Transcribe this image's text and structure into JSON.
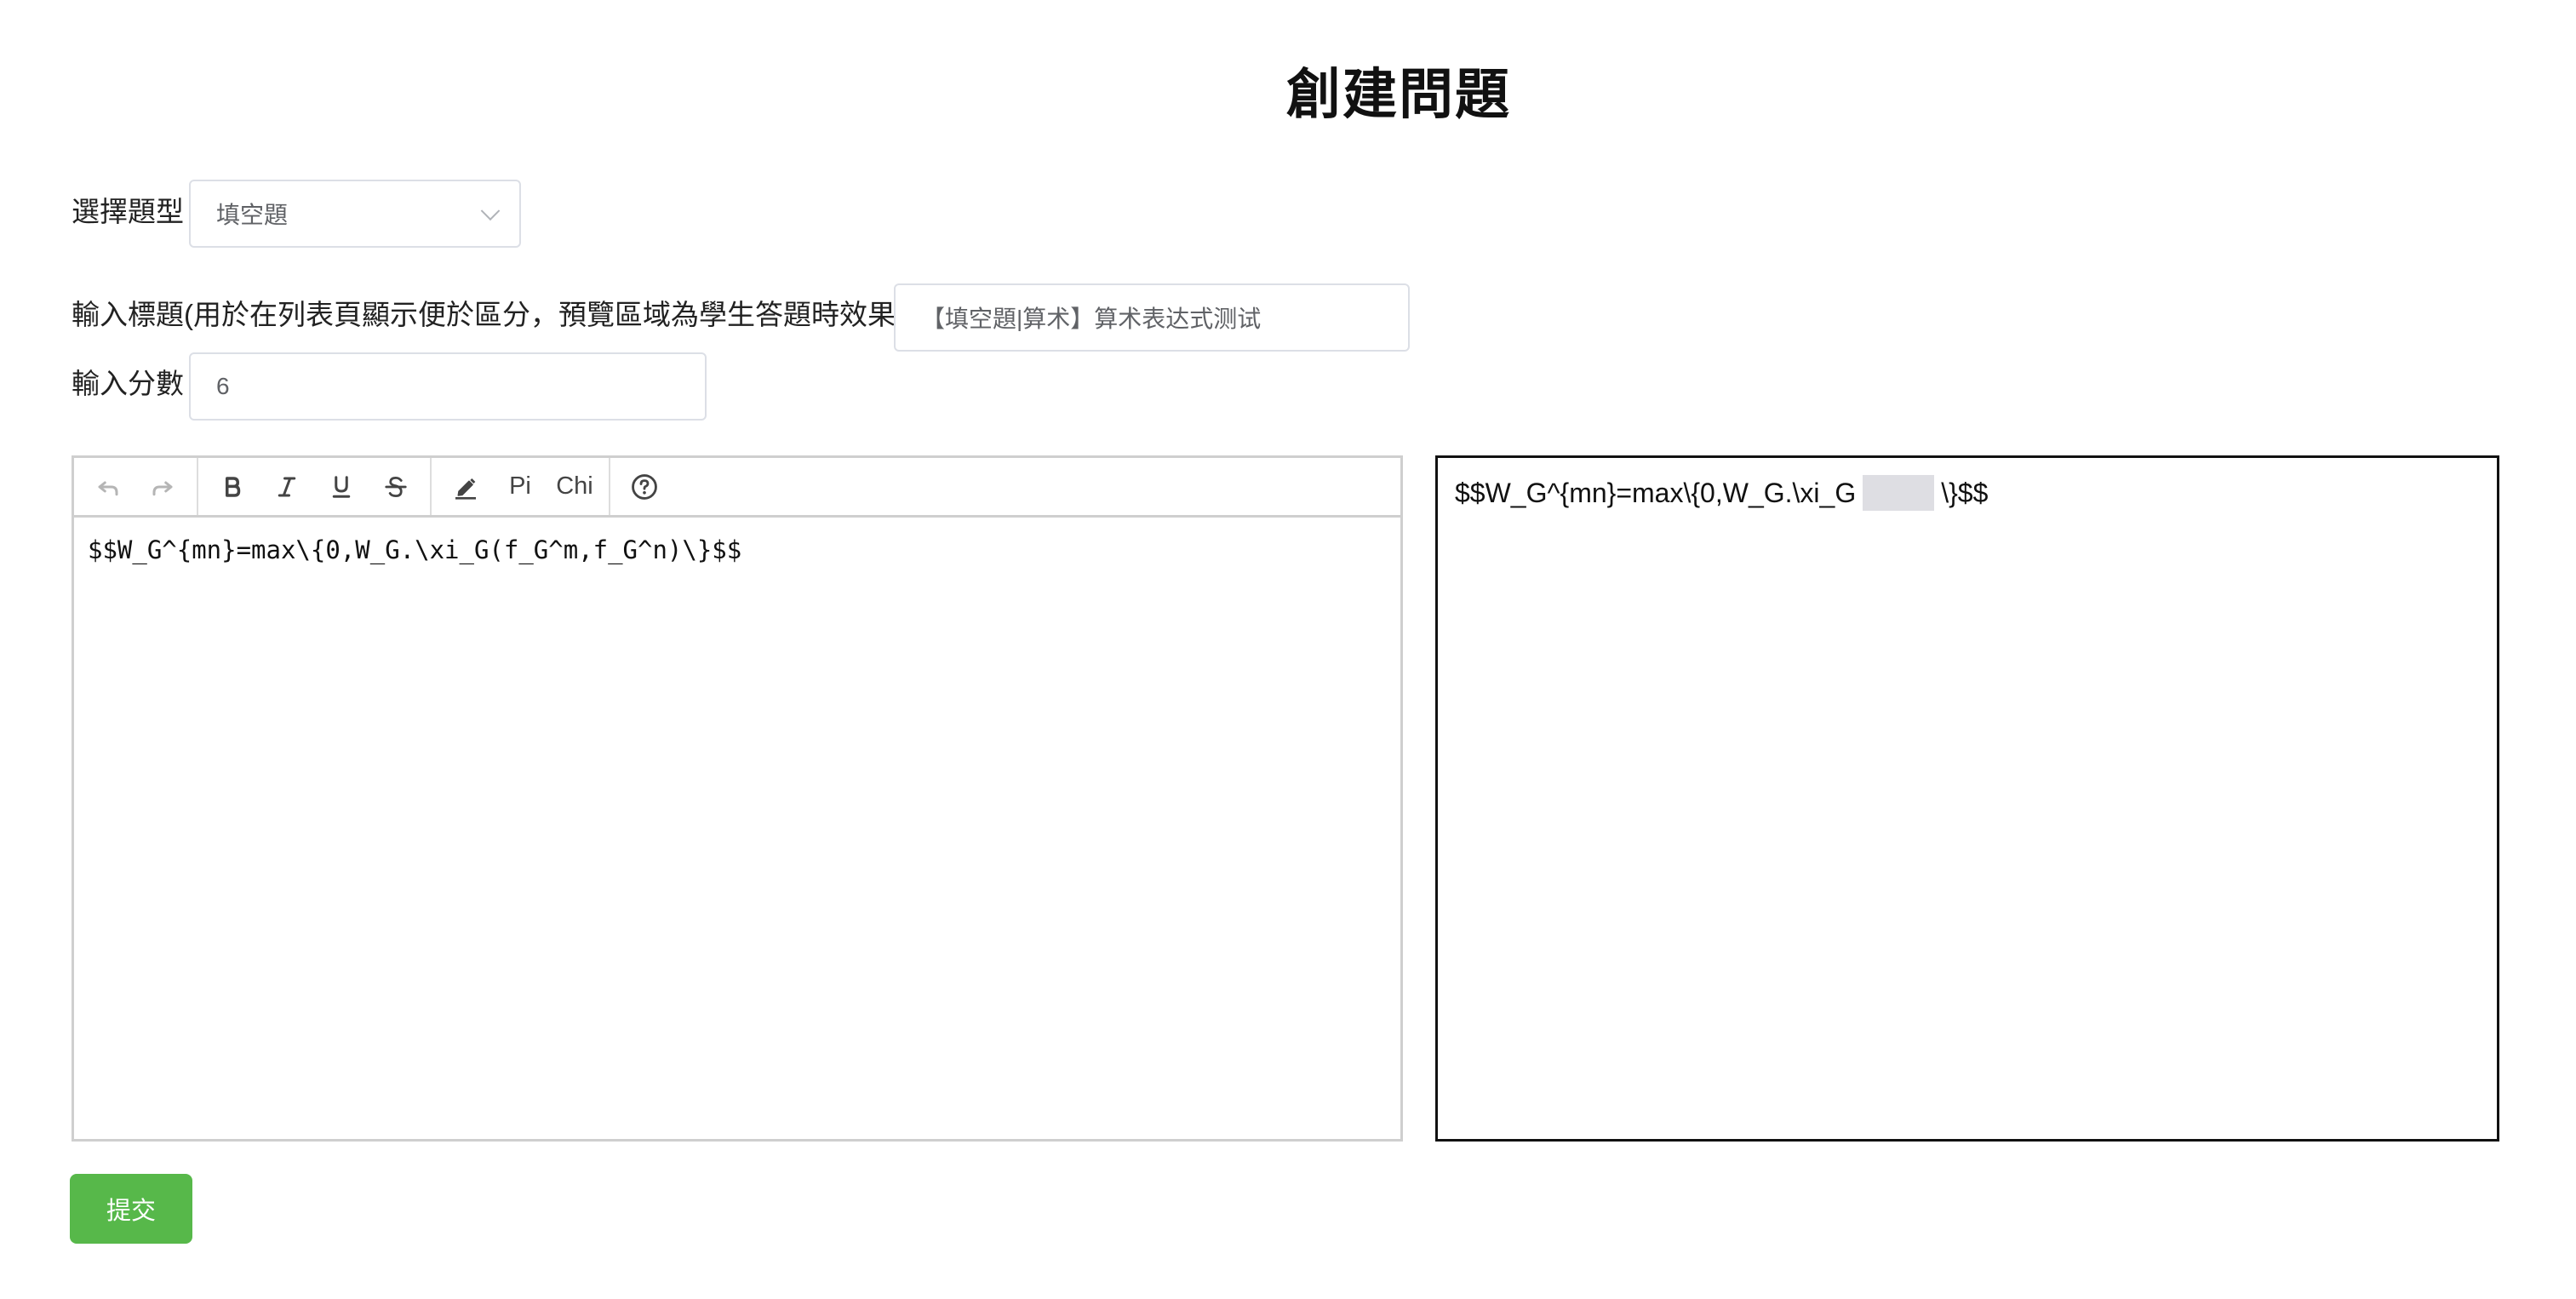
{
  "page": {
    "title": "創建問題"
  },
  "form": {
    "type_label": "選擇題型",
    "type_value": "填空題",
    "title_label": "輸入標題(用於在列表頁顯示便於區分，預覽區域為學生答題時效果)",
    "title_value": "【填空題|算术】算术表达式测试",
    "score_label": "輸入分數",
    "score_value": "6"
  },
  "toolbar": {
    "undo_icon": "undo-icon",
    "redo_icon": "redo-icon",
    "bold_icon": "bold-icon",
    "italic_icon": "italic-icon",
    "underline_icon": "underline-icon",
    "strikethrough_icon": "strikethrough-icon",
    "pen_icon": "pen-icon",
    "pi_label": "Pi",
    "chi_label": "Chi",
    "help_icon": "help-icon"
  },
  "editor": {
    "content": "$$W_G^{mn}=max\\{0,W_G.\\xi_G(f_G^m,f_G^n)\\}$$"
  },
  "preview": {
    "before_blank": "$$W_G^{mn}=max\\{0,W_G.\\xi_G",
    "after_blank": "\\}$$"
  },
  "actions": {
    "submit_label": "提交",
    "submit_color": "#57b84a"
  }
}
